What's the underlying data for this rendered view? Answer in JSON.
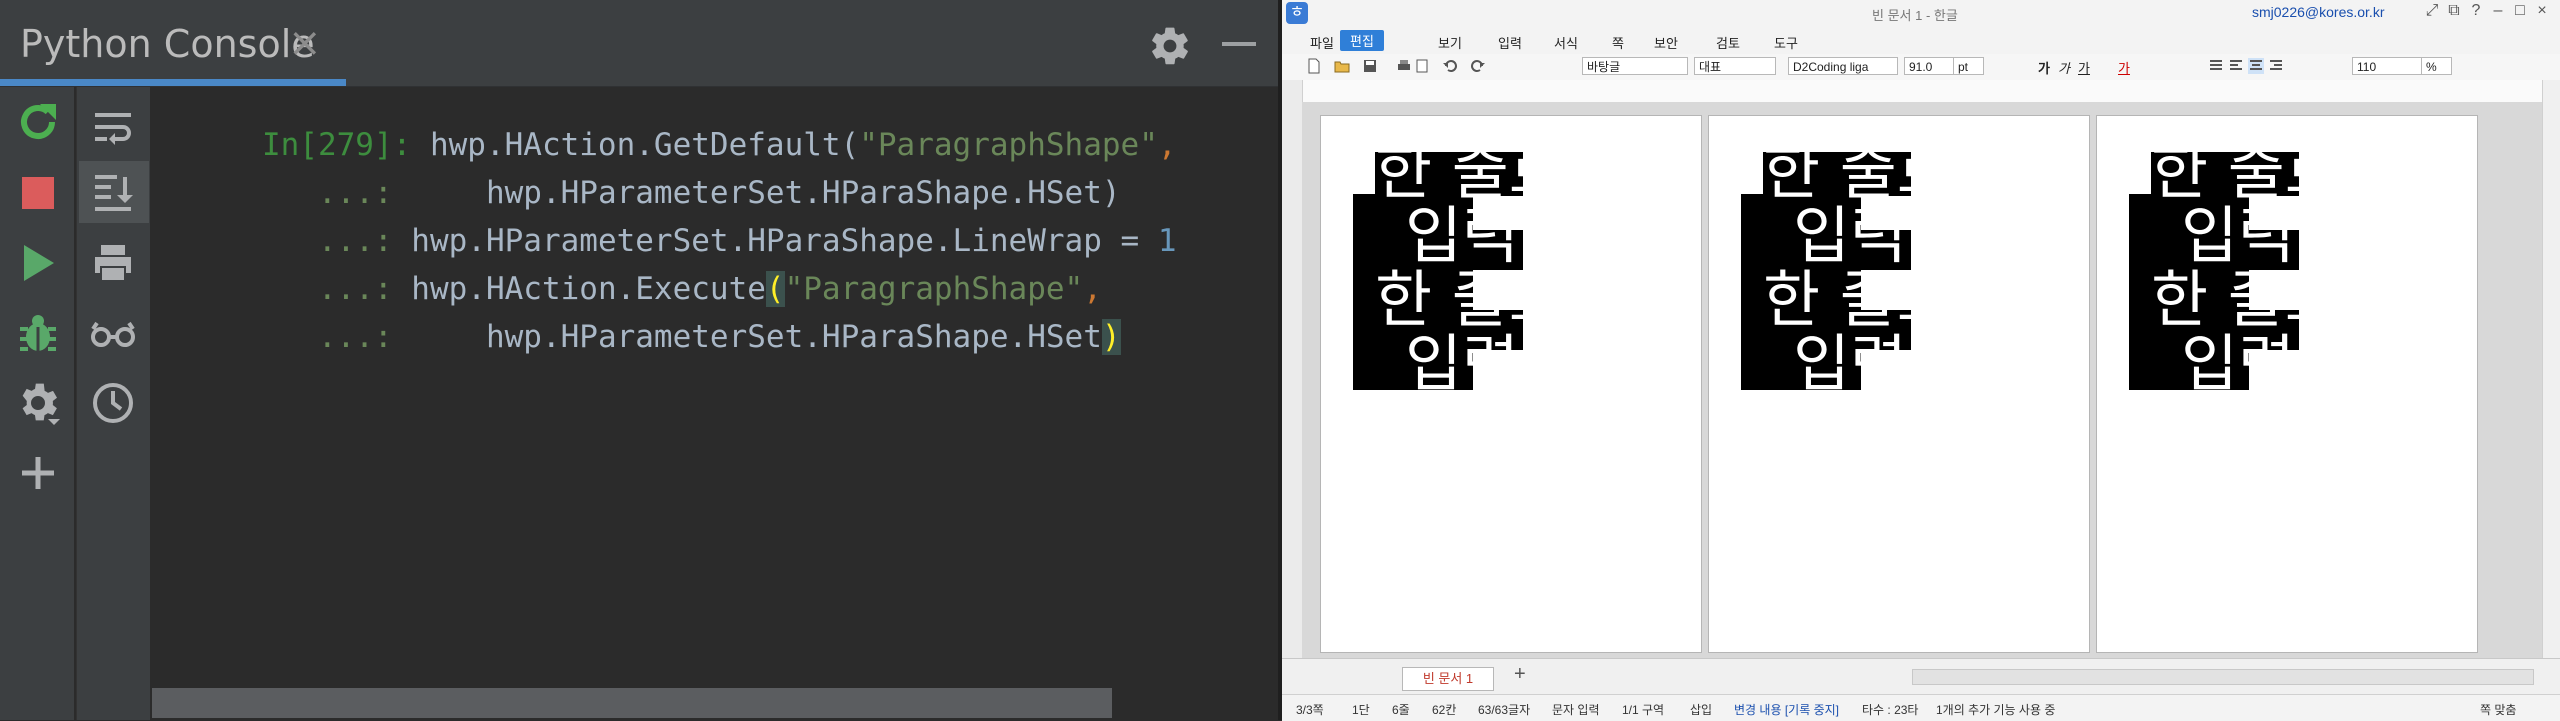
{
  "console": {
    "tab_title": "Python Console",
    "tab_close": "×",
    "code_lines": [
      {
        "prompt": "In[279]:",
        "segments": [
          {
            "text": " hwp.HAction.GetDefault(",
            "cls": ""
          },
          {
            "text": "\"ParagraphShape\"",
            "cls": "str"
          },
          {
            "text": ",",
            "cls": "comma"
          }
        ]
      },
      {
        "prompt": "   ...:",
        "segments": [
          {
            "text": "     hwp.HParameterSet.HParaShape.HSet)",
            "cls": ""
          }
        ]
      },
      {
        "prompt": "   ...:",
        "segments": [
          {
            "text": " hwp.HParameterSet.HParaShape.LineWrap = ",
            "cls": ""
          },
          {
            "text": "1",
            "cls": "num"
          }
        ]
      },
      {
        "prompt": "   ...:",
        "segments": [
          {
            "text": " hwp.HAction.Execute",
            "cls": ""
          },
          {
            "text": "(",
            "cls": "hl"
          },
          {
            "text": "\"ParagraphShape\"",
            "cls": "str"
          },
          {
            "text": ",",
            "cls": "comma"
          }
        ]
      },
      {
        "prompt": "   ...:",
        "segments": [
          {
            "text": "     hwp.HParameterSet.HParaShape.HSet",
            "cls": ""
          },
          {
            "text": ")",
            "cls": "hl"
          }
        ]
      }
    ],
    "toolbar_icons": [
      "rerun-icon",
      "stop-icon",
      "run-icon",
      "debug-icon",
      "settings-icon",
      "add-icon"
    ],
    "toolbar2_icons": [
      "soft-wrap-icon",
      "scroll-to-end-icon",
      "print-icon",
      "show-variables-icon",
      "history-icon"
    ]
  },
  "hwp": {
    "title": "빈 문서 1 - 한글",
    "account": "smj0226@kores.or.kr",
    "menus": [
      "파일",
      "편집",
      "보기",
      "입력",
      "서식",
      "쪽",
      "보안",
      "검토",
      "도구"
    ],
    "active_menu": "편집",
    "style_dropdown": "바탕글",
    "lang_dropdown": "대표",
    "font_dropdown": "D2Coding liga",
    "size_value": "91.0",
    "size_unit": "pt",
    "zoom_value": "110",
    "zoom_unit": "%",
    "page_text": {
      "line1": "한 줄로",
      "line2": "입력"
    },
    "doc_tab": "빈 문서 1",
    "status": {
      "page": "3/3쪽",
      "section": "1단",
      "line": "6줄",
      "column": "62칸",
      "chars": "63/63글자",
      "input": "문자 입력",
      "zone": "1/1 구역",
      "mode": "삽입",
      "changes": "변경 내용 [기록 중지]",
      "taps": "타수 : 23타",
      "extra": "1개의 추가 기능 사용 중",
      "zoom_fit": "쪽 맞춤"
    },
    "colors": {
      "accent": "#2f7fd8",
      "console_tab_underline": "#4a88c7"
    }
  }
}
